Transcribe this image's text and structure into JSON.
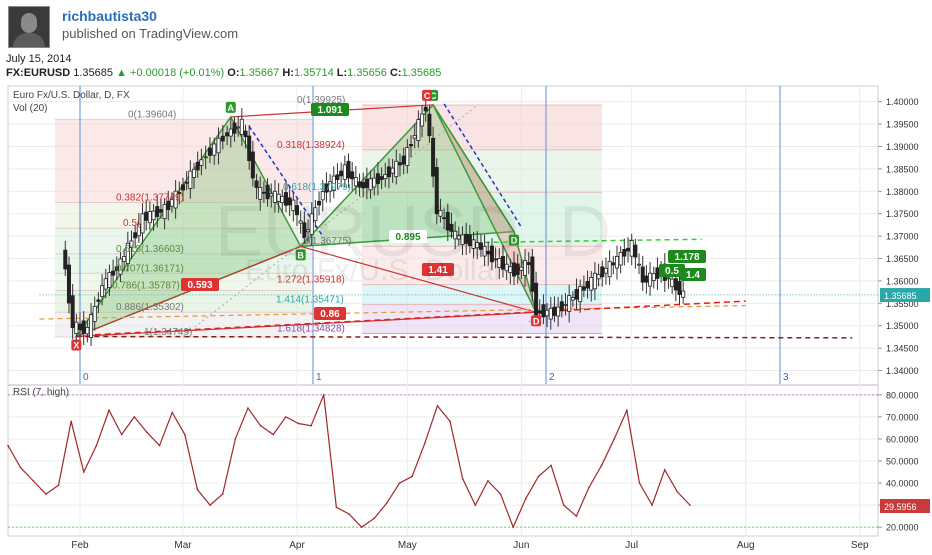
{
  "header": {
    "username": "richbautista30",
    "published": "published on TradingView.com",
    "date": "July 15, 2014",
    "symbol": "FX:EURUSD",
    "last": "1.35685",
    "change": "+0.00018 (+0.01%)",
    "open_label": "O:",
    "open": "1.35667",
    "high_label": "H:",
    "high": "1.35714",
    "low_label": "L:",
    "low": "1.35656",
    "close_label": "C:",
    "close": "1.35685"
  },
  "chart_data": [
    {
      "type": "line",
      "title": "Euro Fx/U.S. Dollar, D, FX",
      "subtitle": "Vol (20)",
      "watermark": "EURUSD, D",
      "watermark_sub": "Euro Fx/U.S. Dollar",
      "ylim": [
        1.337,
        1.4035
      ],
      "y_ticks": [
        "1.40000",
        "1.39500",
        "1.39000",
        "1.38500",
        "1.38000",
        "1.37500",
        "1.37000",
        "1.36500",
        "1.36000",
        "1.35500",
        "1.35000",
        "1.34500",
        "1.34000"
      ],
      "x_ticks": [
        "Feb",
        "Mar",
        "Apr",
        "May",
        "Jun",
        "Jul",
        "Aug",
        "Sep"
      ],
      "last_price_label": "1.35685",
      "time_cycle_labels": [
        "0",
        "1",
        "2",
        "3"
      ],
      "fib_labels_left": [
        "0(1.39604)",
        "0.382(1.37749)",
        "0.5(",
        "0.618(1.36603)",
        "0.707(1.36171)",
        "0.786(1.35787)",
        "0.886(1.35302)",
        "1(1.34749)"
      ],
      "fib_labels_right": [
        "0(1.39925)",
        "0.318(1.38924)",
        "0.618(1.37979)",
        "1(1.36775)",
        "1.272(1.35918)",
        "1.414(1.35471)",
        "1.618(1.34828)"
      ],
      "pattern_labels": [
        "X",
        "A",
        "B",
        "C",
        "D",
        "C",
        "D"
      ],
      "ratio_labels": [
        "1.091",
        "0.593",
        "0.895",
        "1.41",
        "0.86",
        "1.178",
        "0.5",
        "1.4"
      ],
      "price_series": [
        {
          "date": "Jan 27",
          "close": 1.368
        },
        {
          "date": "Jan 30",
          "close": 1.35
        },
        {
          "date": "Feb 3",
          "close": 1.349
        },
        {
          "date": "Feb 7",
          "close": 1.359
        },
        {
          "date": "Feb 12",
          "close": 1.364
        },
        {
          "date": "Feb 18",
          "close": 1.374
        },
        {
          "date": "Feb 24",
          "close": 1.376
        },
        {
          "date": "Feb 28",
          "close": 1.38
        },
        {
          "date": "Mar 6",
          "close": 1.387
        },
        {
          "date": "Mar 13",
          "close": 1.393
        },
        {
          "date": "Mar 17",
          "close": 1.395
        },
        {
          "date": "Mar 21",
          "close": 1.38
        },
        {
          "date": "Mar 26",
          "close": 1.379
        },
        {
          "date": "Mar 31",
          "close": 1.377
        },
        {
          "date": "Apr 3",
          "close": 1.37
        },
        {
          "date": "Apr 8",
          "close": 1.38
        },
        {
          "date": "Apr 14",
          "close": 1.385
        },
        {
          "date": "Apr 18",
          "close": 1.381
        },
        {
          "date": "Apr 24",
          "close": 1.383
        },
        {
          "date": "Apr 30",
          "close": 1.387
        },
        {
          "date": "May 6",
          "close": 1.399
        },
        {
          "date": "May 9",
          "close": 1.376
        },
        {
          "date": "May 14",
          "close": 1.37
        },
        {
          "date": "May 20",
          "close": 1.368
        },
        {
          "date": "May 26",
          "close": 1.364
        },
        {
          "date": "May 30",
          "close": 1.362
        },
        {
          "date": "Jun 3",
          "close": 1.364
        },
        {
          "date": "Jun 5",
          "close": 1.353
        },
        {
          "date": "Jun 10",
          "close": 1.353
        },
        {
          "date": "Jun 16",
          "close": 1.357
        },
        {
          "date": "Jun 20",
          "close": 1.36
        },
        {
          "date": "Jun 26",
          "close": 1.364
        },
        {
          "date": "Jul 1",
          "close": 1.368
        },
        {
          "date": "Jul 4",
          "close": 1.36
        },
        {
          "date": "Jul 9",
          "close": 1.362
        },
        {
          "date": "Jul 15",
          "close": 1.3569
        }
      ]
    },
    {
      "type": "line",
      "title": "RSI (7, high)",
      "ylim": [
        16,
        84
      ],
      "y_ticks": [
        "80.0000",
        "70.0000",
        "60.0000",
        "50.0000",
        "40.0000",
        "30.0000",
        "20.0000"
      ],
      "last_value_label": "29.5956",
      "series": [
        {
          "values": [
            57,
            47,
            41,
            35,
            39,
            68,
            45,
            57,
            73,
            62,
            70,
            63,
            57,
            72,
            62,
            37,
            30,
            35,
            60,
            74,
            66,
            62,
            70,
            67,
            66,
            80,
            29,
            26,
            20,
            24,
            31,
            40,
            43,
            58,
            75,
            68,
            42,
            30,
            41,
            35,
            20,
            33,
            43,
            48,
            30,
            25,
            38,
            48,
            60,
            73,
            40,
            30,
            46,
            36,
            30
          ]
        }
      ]
    }
  ]
}
